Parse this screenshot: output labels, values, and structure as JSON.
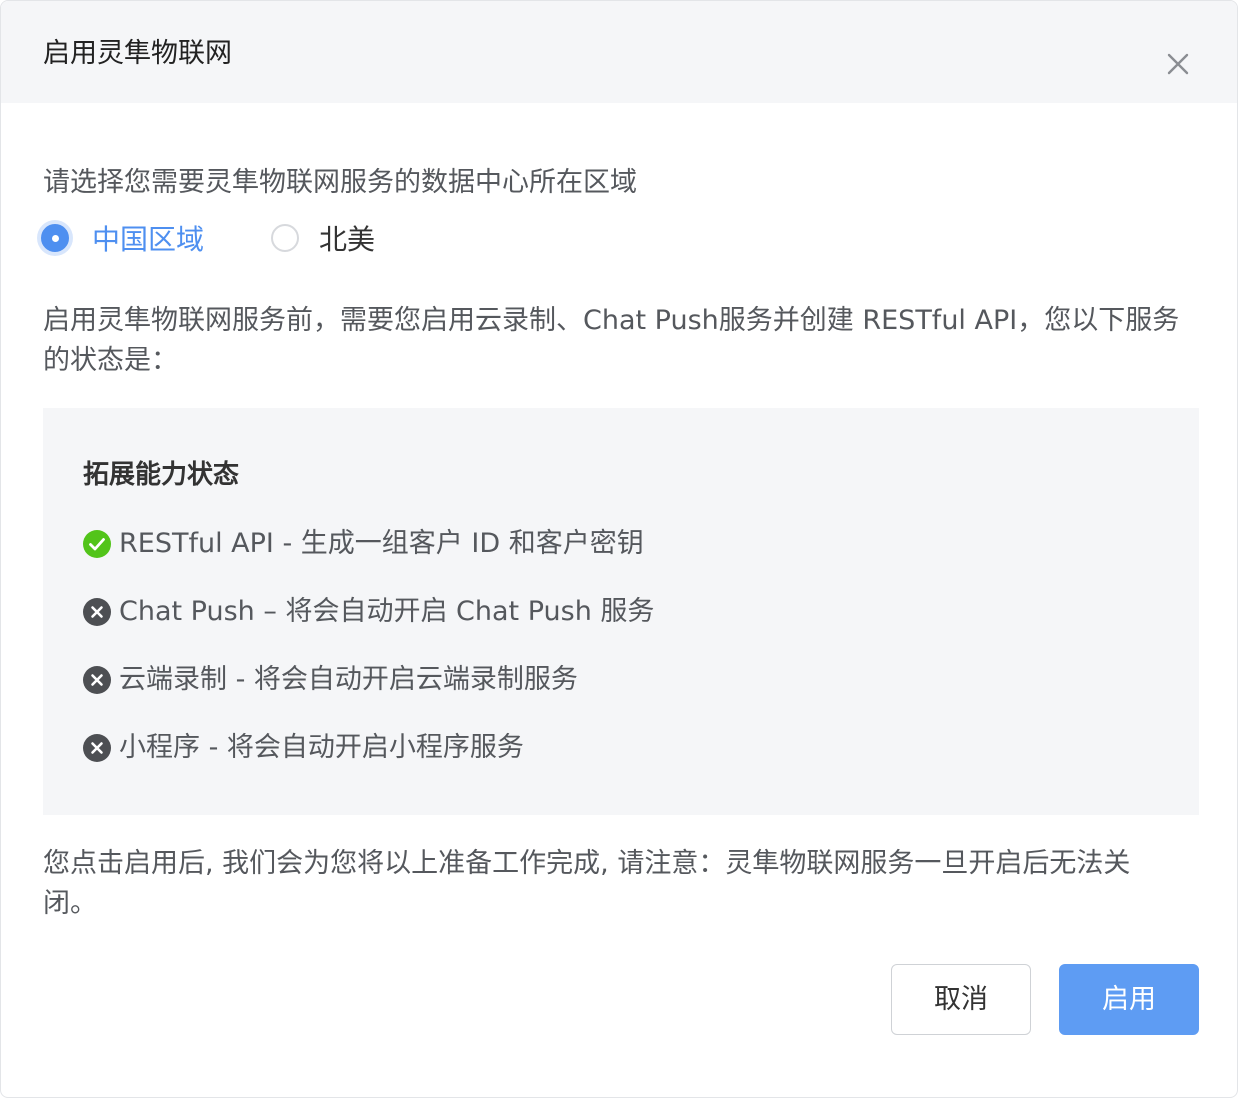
{
  "dialog": {
    "title": "启用灵隼物联网",
    "close_icon": "close-icon"
  },
  "region": {
    "prompt": "请选择您需要灵隼物联网服务的数据中心所在区域",
    "options": [
      {
        "label": "中国区域",
        "selected": true
      },
      {
        "label": "北美",
        "selected": false
      }
    ]
  },
  "description": "启用灵隼物联网服务前，需要您启用云录制、Chat Push服务并创建 RESTful API，您以下服务的状态是：",
  "status": {
    "title": "拓展能力状态",
    "items": [
      {
        "text": "RESTful API - 生成一组客户 ID 和客户密钥",
        "state": "done",
        "icon": "check-circle-icon"
      },
      {
        "text": "Chat Push – 将会自动开启 Chat Push 服务",
        "state": "pending",
        "icon": "x-circle-icon"
      },
      {
        "text": "云端录制 - 将会自动开启云端录制服务",
        "state": "pending",
        "icon": "x-circle-icon"
      },
      {
        "text": "小程序 - 将会自动开启小程序服务",
        "state": "pending",
        "icon": "x-circle-icon"
      }
    ]
  },
  "note": "您点击启用后, 我们会为您将以上准备工作完成, 请注意：灵隼物联网服务一旦开启后无法关闭。",
  "buttons": {
    "cancel_label": "取消",
    "enable_label": "启用"
  },
  "colors": {
    "accent": "#4e8ff0",
    "primary_button": "#5e9cf3",
    "success": "#52c41a",
    "pending": "#4d4f53"
  }
}
